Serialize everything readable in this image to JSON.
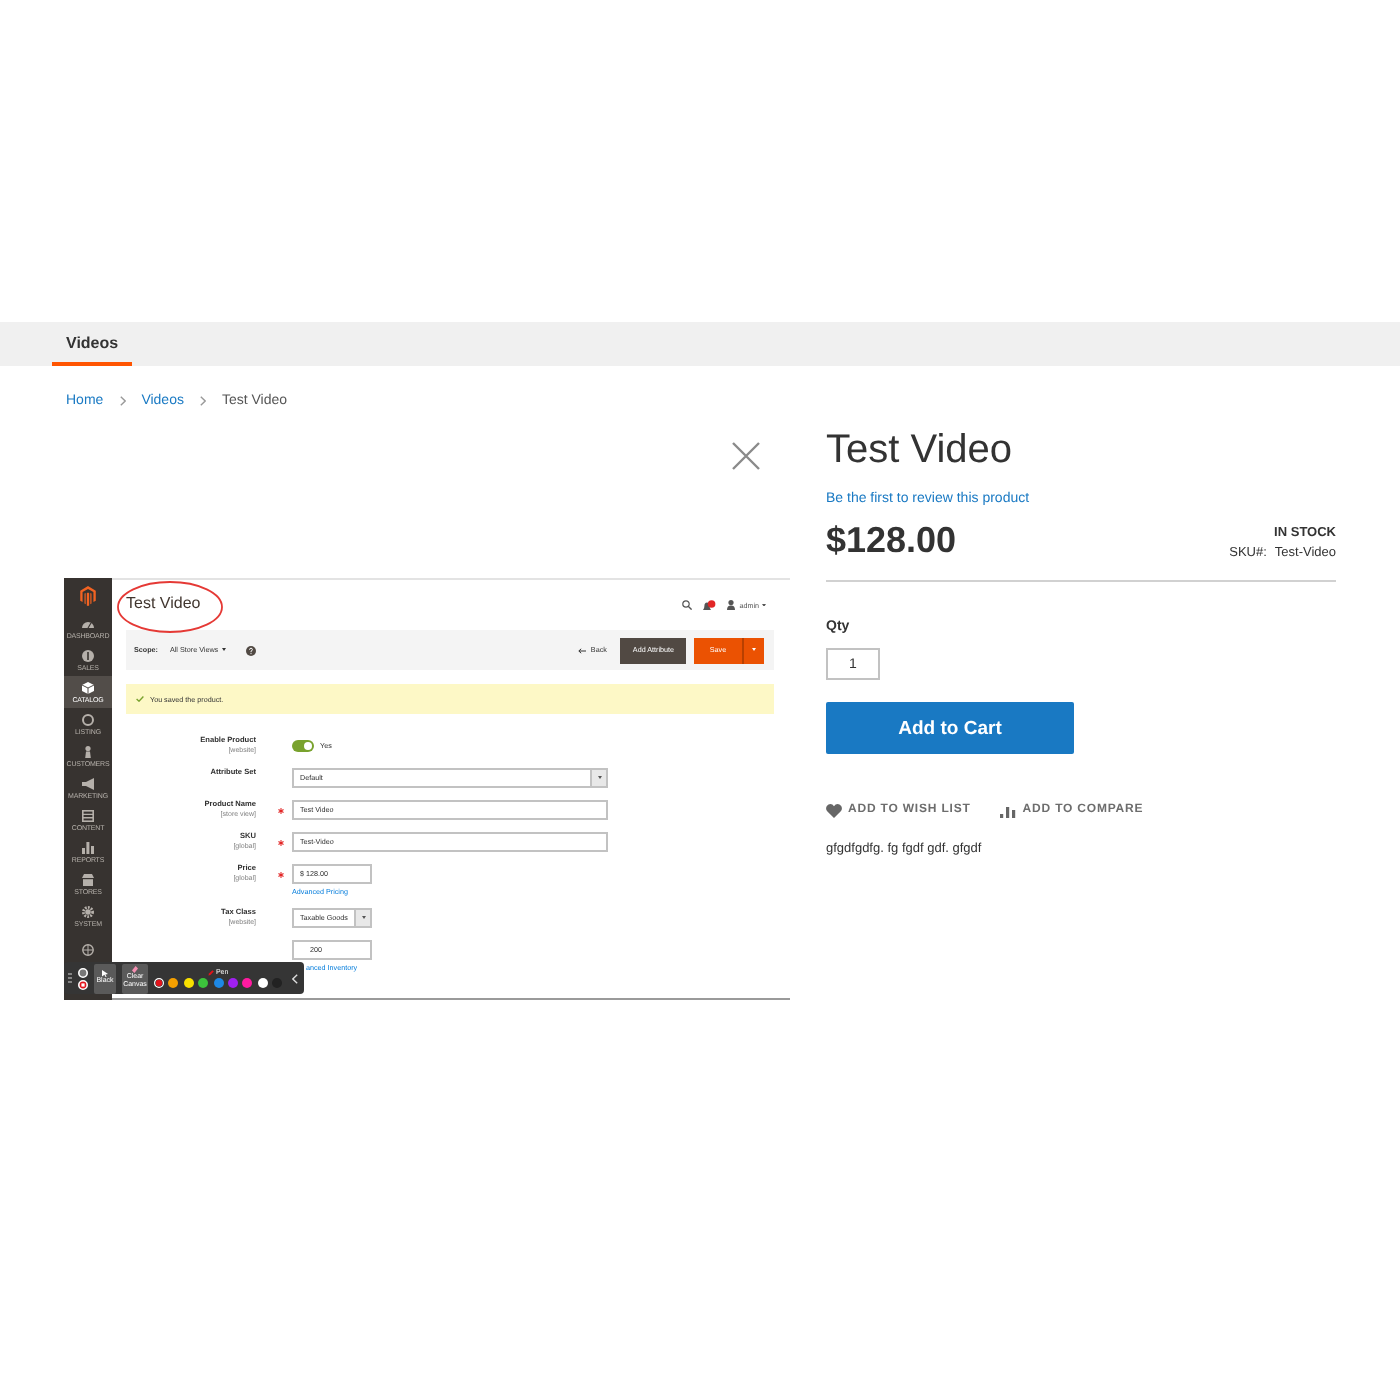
{
  "nav": {
    "items": [
      {
        "label": "Videos",
        "selected": true
      }
    ]
  },
  "breadcrumbs": [
    {
      "label": "Home",
      "kind": "link"
    },
    {
      "label": "Videos",
      "kind": "link"
    },
    {
      "label": "Test Video",
      "kind": "current"
    }
  ],
  "gallery": {
    "screenshot": {
      "sidebar": [
        {
          "kind": "dashboard",
          "label": "DASHBOARD",
          "selected": false
        },
        {
          "kind": "sales",
          "label": "SALES",
          "selected": false
        },
        {
          "kind": "catalog",
          "label": "CATALOG",
          "selected": true
        },
        {
          "kind": "listing",
          "label": "LISTING",
          "selected": false
        },
        {
          "kind": "customers",
          "label": "CUSTOMERS",
          "selected": false
        },
        {
          "kind": "marketing",
          "label": "MARKETING",
          "selected": false
        },
        {
          "kind": "content",
          "label": "CONTENT",
          "selected": false
        },
        {
          "kind": "reports",
          "label": "REPORTS",
          "selected": false
        },
        {
          "kind": "stores",
          "label": "STORES",
          "selected": false
        },
        {
          "kind": "system",
          "label": "SYSTEM",
          "selected": false
        },
        {
          "kind": "partners",
          "selected": false
        }
      ],
      "title": "Test Video",
      "user": "admin",
      "scope_label": "Scope:",
      "scope": "All Store Views",
      "back": "Back",
      "add_attribute": "Add Attribute",
      "save": "Save",
      "message": "You saved the product.",
      "fields": [
        {
          "kind": "toggle",
          "label": "Enable Product",
          "scope": "[website]",
          "required": false,
          "on": true,
          "value": "Yes"
        },
        {
          "kind": "select",
          "label": "Attribute Set",
          "required": false,
          "value": "Default"
        },
        {
          "kind": "input",
          "label": "Product Name",
          "scope": "[store view]",
          "required": true,
          "value": "Test Video"
        },
        {
          "kind": "input",
          "label": "SKU",
          "scope": "[global]",
          "required": true,
          "value": "Test-Video"
        },
        {
          "kind": "input-short",
          "label": "Price",
          "scope": "[global]",
          "required": true,
          "value": "$ 128.00",
          "link": "Advanced Pricing"
        },
        {
          "kind": "select-short",
          "label": "Tax Class",
          "scope": "[website]",
          "required": false,
          "value": "Taxable Goods"
        },
        {
          "kind": "input-short",
          "required": false,
          "value": "200",
          "link": "anced Inventory"
        }
      ],
      "annotation_toolbar": {
        "buttons": [
          {
            "kind": "pointer",
            "label": "Black"
          },
          {
            "kind": "clear",
            "label": "Clear Canvas"
          }
        ],
        "tool": "Pen",
        "colors": [
          {
            "color": "#e3131b",
            "selected": true
          },
          {
            "color": "#f5a000",
            "selected": false
          },
          {
            "color": "#f8e000",
            "selected": false
          },
          {
            "color": "#3cc43c",
            "selected": false
          },
          {
            "color": "#1e88e5",
            "selected": false
          },
          {
            "color": "#a020f0",
            "selected": false
          },
          {
            "color": "#ff1aa0",
            "selected": false
          },
          {
            "color": "#ffffff",
            "selected": false
          },
          {
            "color": "#222222",
            "selected": false
          }
        ]
      }
    }
  },
  "product": {
    "title": "Test Video",
    "review_link": "Be the first to review this product",
    "price": "$128.00",
    "stock": "IN STOCK",
    "sku_label": "SKU#:",
    "sku": "Test-Video",
    "qty_label": "Qty",
    "qty": "1",
    "add_to_cart": "Add to Cart",
    "actions": [
      {
        "kind": "wishlist",
        "label": "ADD TO WISH LIST"
      },
      {
        "kind": "compare",
        "label": "ADD TO COMPARE"
      }
    ],
    "description": "gfgdfgdfg. fg fgdf gdf. gfgdf"
  }
}
